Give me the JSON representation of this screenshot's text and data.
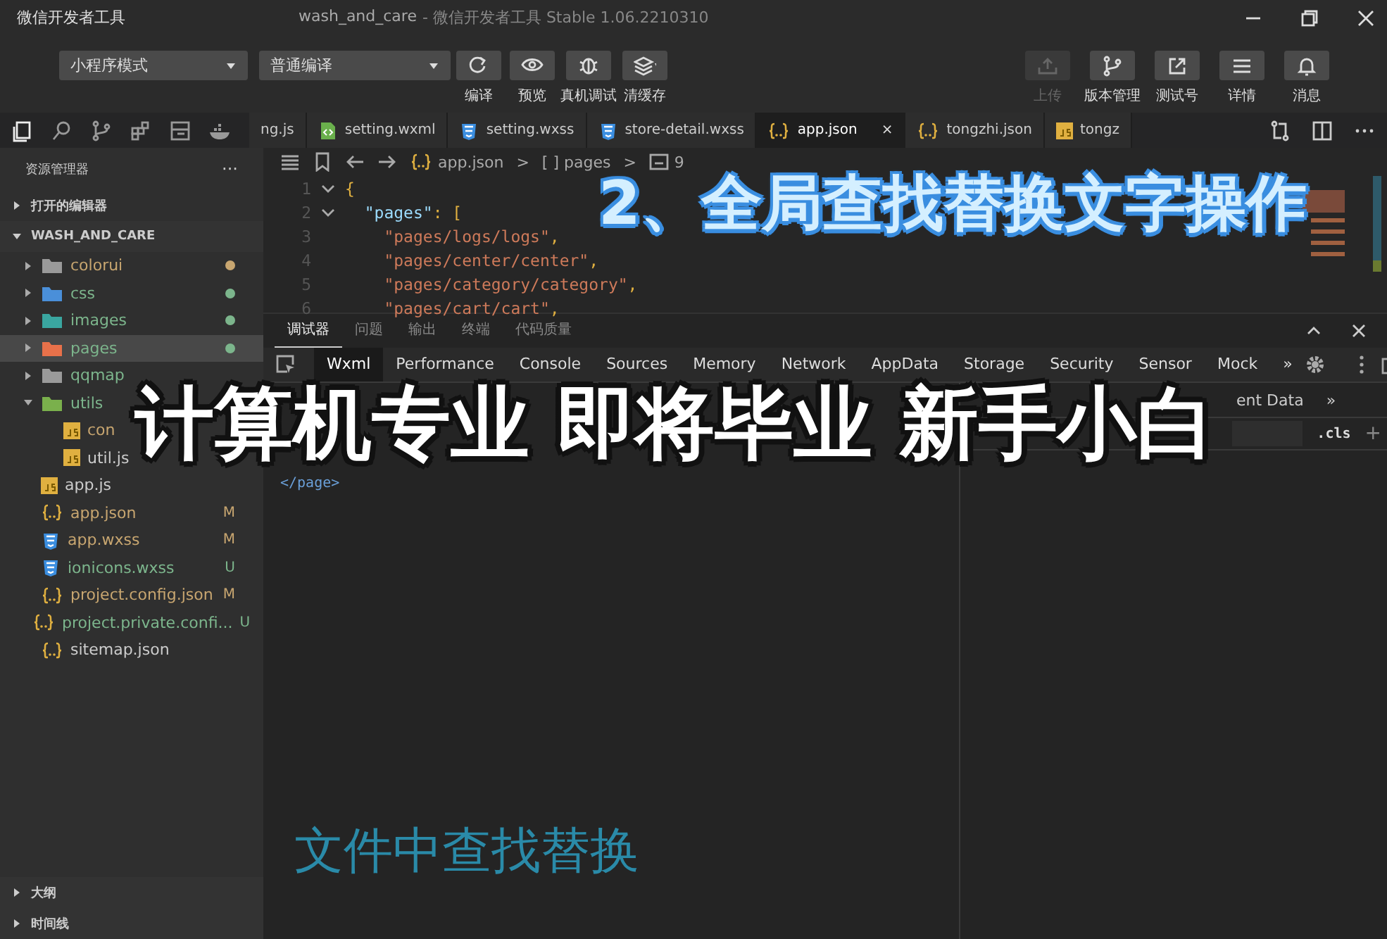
{
  "window": {
    "app_title": "微信开发者工具",
    "project": "wash_and_care",
    "title": "- 微信开发者工具 Stable 1.06.2210310"
  },
  "toolbar": {
    "mode_select": "小程序模式",
    "compile_select": "普通编译",
    "left_buttons": [
      {
        "label": "编译",
        "kind": "refresh"
      },
      {
        "label": "预览",
        "kind": "eye"
      },
      {
        "label": "真机调试",
        "kind": "bug"
      },
      {
        "label": "清缓存",
        "kind": "layers"
      }
    ],
    "right_buttons": [
      {
        "label": "上传",
        "kind": "upload",
        "disabled": true
      },
      {
        "label": "版本管理",
        "kind": "branch",
        "disabled": false
      },
      {
        "label": "测试号",
        "kind": "external",
        "disabled": false
      },
      {
        "label": "详情",
        "kind": "menu",
        "disabled": false
      },
      {
        "label": "消息",
        "kind": "bell",
        "disabled": false
      }
    ]
  },
  "editor_tabs": [
    {
      "label": "ng.js",
      "kind": "plain",
      "selected": false
    },
    {
      "label": "setting.wxml",
      "kind": "wxml",
      "selected": false
    },
    {
      "label": "setting.wxss",
      "kind": "css",
      "selected": false
    },
    {
      "label": "store-detail.wxss",
      "kind": "css",
      "selected": false
    },
    {
      "label": "app.json",
      "kind": "json",
      "selected": true,
      "close": "×"
    },
    {
      "label": "tongzhi.json",
      "kind": "json",
      "selected": false
    },
    {
      "label": "tongz",
      "kind": "js",
      "selected": false
    }
  ],
  "sidebar": {
    "title": "资源管理器",
    "more": "···",
    "sections": [
      {
        "label": "打开的编辑器",
        "expanded": false
      },
      {
        "label": "WASH_AND_CARE",
        "expanded": true
      }
    ],
    "items": [
      {
        "name": "colorui",
        "kind": "folder-grey",
        "expanded": false,
        "selected": false,
        "color": "#c8a670",
        "dot": true
      },
      {
        "name": "css",
        "kind": "folder-blue",
        "expanded": false,
        "selected": false,
        "color": "#7cb58c",
        "dot": true
      },
      {
        "name": "images",
        "kind": "folder-teal",
        "expanded": false,
        "selected": false,
        "color": "#7cb58c",
        "dot": true
      },
      {
        "name": "pages",
        "kind": "folder-orange",
        "expanded": false,
        "selected": true,
        "color": "#7cb58c",
        "dot": true
      },
      {
        "name": "qqmap",
        "kind": "folder-grey",
        "expanded": false,
        "selected": false,
        "color": "#7cb58c"
      },
      {
        "name": "utils",
        "kind": "folder-green",
        "expanded": true,
        "selected": false,
        "color": "#7cb58c",
        "children": [
          {
            "name": "con",
            "kind": "js",
            "selected": false,
            "color": "#c8a670"
          },
          {
            "name": "util.js",
            "kind": "js",
            "selected": false,
            "color": "#cccccc"
          }
        ]
      },
      {
        "name": "app.js",
        "kind": "js",
        "selected": false,
        "color": "#cccccc"
      },
      {
        "name": "app.json",
        "kind": "json",
        "selected": false,
        "color": "#c8a670",
        "badge": "M"
      },
      {
        "name": "app.wxss",
        "kind": "css",
        "selected": false,
        "color": "#c8a670",
        "badge": "M"
      },
      {
        "name": "ionicons.wxss",
        "kind": "css",
        "selected": false,
        "color": "#7cb58c",
        "badge": "U"
      },
      {
        "name": "project.config.json",
        "kind": "json",
        "selected": false,
        "color": "#c8a670",
        "badge": "M"
      },
      {
        "name": "project.private.confi...",
        "kind": "json",
        "selected": false,
        "color": "#7cb58c",
        "badge": "U"
      },
      {
        "name": "sitemap.json",
        "kind": "json",
        "selected": false,
        "color": "#cccccc"
      }
    ],
    "bottom_sections": [
      {
        "label": "大纲",
        "expanded": false
      },
      {
        "label": "时间线",
        "expanded": false
      }
    ]
  },
  "breadcrumb": {
    "file": "app.json",
    "sep": ">",
    "node": "[ ] pages",
    "sep2": ">",
    "leaf": "9"
  },
  "code_lines": [
    {
      "number": "1",
      "text": "{",
      "fold": true
    },
    {
      "number": "2",
      "text": "  \"pages\": [",
      "fold": true
    },
    {
      "number": "3",
      "text": "    \"pages/logs/logs\",",
      "fold": false
    },
    {
      "number": "4",
      "text": "    \"pages/center/center\",",
      "fold": false
    },
    {
      "number": "5",
      "text": "    \"pages/category/category\",",
      "fold": false
    },
    {
      "number": "6",
      "text": "    \"pages/cart/cart\",",
      "fold": false
    }
  ],
  "panel_tabs": [
    {
      "label": "调试器",
      "selected": true
    },
    {
      "label": "问题",
      "selected": false
    },
    {
      "label": "输出",
      "selected": false
    },
    {
      "label": "终端",
      "selected": false
    },
    {
      "label": "代码质量",
      "selected": false
    }
  ],
  "devtools_tabs": [
    {
      "label": "Wxml",
      "selected": true
    },
    {
      "label": "Performance",
      "selected": false
    },
    {
      "label": "Console",
      "selected": false
    },
    {
      "label": "Sources",
      "selected": false
    },
    {
      "label": "Memory",
      "selected": false
    },
    {
      "label": "Network",
      "selected": false
    },
    {
      "label": "AppData",
      "selected": false
    },
    {
      "label": "Storage",
      "selected": false
    },
    {
      "label": "Security",
      "selected": false
    },
    {
      "label": "Sensor",
      "selected": false
    },
    {
      "label": "Mock",
      "selected": false
    },
    {
      "label": "»",
      "selected": false
    }
  ],
  "wxml_lines": [
    "</page>"
  ],
  "styles_pane": {
    "tab": "ent Data",
    "more": "»",
    "cls": ".cls",
    "add": "+"
  },
  "captions": [
    {
      "kind": "blue",
      "text": "2、全局查找替换文字操作"
    },
    {
      "kind": "outline",
      "text": "计算机专业 即将毕业 新手小白"
    },
    {
      "kind": "teal",
      "text": "文件中查找替换"
    }
  ]
}
